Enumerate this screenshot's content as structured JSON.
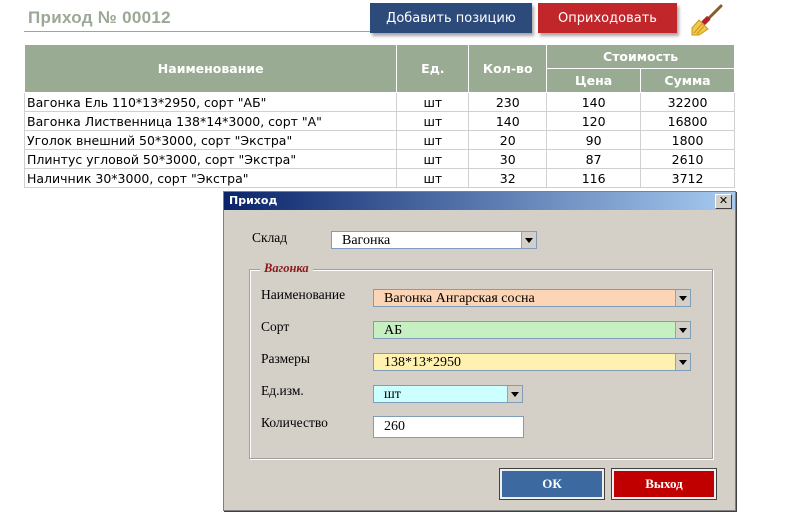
{
  "header": {
    "title": "Приход № 00012",
    "add_button": "Добавить позицию",
    "post_button": "Оприходовать",
    "accent_colors": {
      "add": "#2c4a7a",
      "post": "#c0262a",
      "table_header": "#9aab93"
    }
  },
  "table": {
    "headers": {
      "name": "Наименование",
      "unit": "Ед.",
      "qty": "Кол-во",
      "cost": "Стоимость",
      "price": "Цена",
      "sum": "Сумма"
    },
    "rows": [
      {
        "name": "Вагонка Ель 110*13*2950, сорт \"АБ\"",
        "unit": "шт",
        "qty": "230",
        "price": "140",
        "sum": "32200"
      },
      {
        "name": "Вагонка Лиственница 138*14*3000, сорт \"А\"",
        "unit": "шт",
        "qty": "140",
        "price": "120",
        "sum": "16800"
      },
      {
        "name": "Уголок внешний 50*3000, сорт \"Экстра\"",
        "unit": "шт",
        "qty": "20",
        "price": "90",
        "sum": "1800"
      },
      {
        "name": "Плинтус угловой 50*3000, сорт \"Экстра\"",
        "unit": "шт",
        "qty": "30",
        "price": "87",
        "sum": "2610"
      },
      {
        "name": "Наличник  30*3000, сорт \"Экстра\"",
        "unit": "шт",
        "qty": "32",
        "price": "116",
        "sum": "3712"
      }
    ]
  },
  "dialog": {
    "title": "Приход",
    "warehouse_label": "Склад",
    "warehouse_value": "Вагонка",
    "group_caption": "Вагонка",
    "name_label": "Наименование",
    "name_value": "Вагонка Ангарская сосна",
    "grade_label": "Сорт",
    "grade_value": "АБ",
    "size_label": "Размеры",
    "size_value": "138*13*2950",
    "unit_label": "Ед.изм.",
    "unit_value": "шт",
    "qty_label": "Количество",
    "qty_value": "260",
    "ok_button": "ОК",
    "exit_button": "Выход",
    "field_colors": {
      "name": "#fbd5b5",
      "grade": "#c6f0c2",
      "size": "#fff2b0",
      "unit": "#ccffff"
    }
  }
}
